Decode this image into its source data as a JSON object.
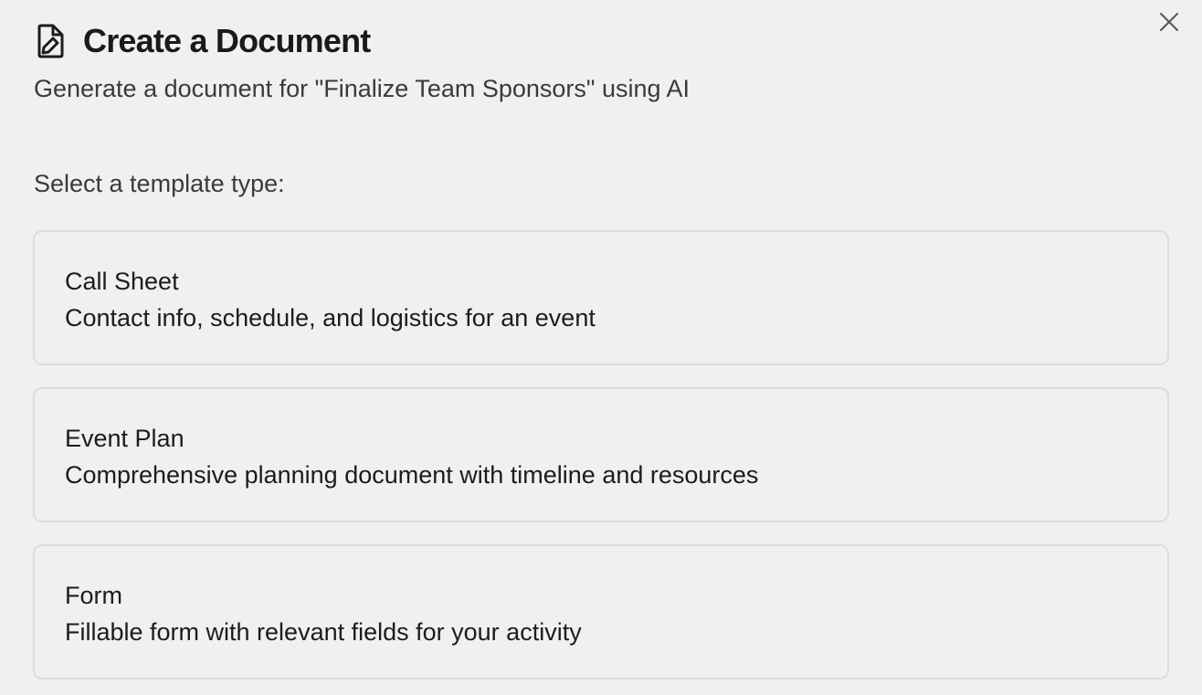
{
  "dialog": {
    "title": "Create a Document",
    "subtitle": "Generate a document for \"Finalize Team Sponsors\" using AI",
    "prompt": "Select a template type:",
    "icons": {
      "title_icon": "document-edit-icon",
      "close_icon": "close-icon"
    }
  },
  "templates": [
    {
      "name": "Call Sheet",
      "description": "Contact info, schedule, and logistics for an event"
    },
    {
      "name": "Event Plan",
      "description": "Comprehensive planning document with timeline and resources"
    },
    {
      "name": "Form",
      "description": "Fillable form with relevant fields for your activity"
    }
  ],
  "colors": {
    "background": "#f0f0f0",
    "card_border": "#dddddf",
    "text": "#1c1c1e"
  }
}
